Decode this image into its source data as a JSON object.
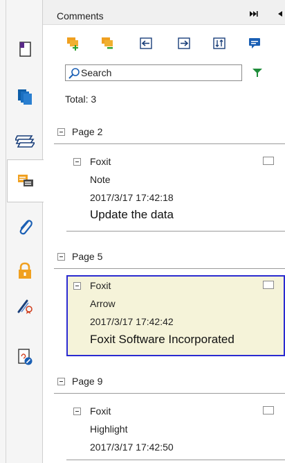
{
  "panel": {
    "title": "Comments",
    "collapse_glyph": "⏩",
    "prev_glyph": "◀"
  },
  "toolbar": {
    "buttons": [
      {
        "name": "expand-all-icon"
      },
      {
        "name": "collapse-all-icon"
      },
      {
        "name": "import-comments-icon"
      },
      {
        "name": "export-comments-icon"
      },
      {
        "name": "sort-comments-icon"
      },
      {
        "name": "comment-options-icon"
      }
    ]
  },
  "search": {
    "placeholder": "Search"
  },
  "total": {
    "text": "Total: 3"
  },
  "pages": [
    {
      "label": "Page 2",
      "comments": [
        {
          "author": "Foxit",
          "type": "Note",
          "date": "2017/3/17 17:42:18",
          "text": "Update the data",
          "selected": false
        }
      ]
    },
    {
      "label": "Page 5",
      "comments": [
        {
          "author": "Foxit",
          "type": "Arrow",
          "date": "2017/3/17 17:42:42",
          "text": "Foxit Software Incorporated",
          "selected": true
        }
      ]
    },
    {
      "label": "Page 9",
      "comments": [
        {
          "author": "Foxit",
          "type": "Highlight",
          "date": "2017/3/17 17:42:50",
          "text": "",
          "selected": false
        }
      ]
    }
  ],
  "rail": {
    "items": [
      {
        "name": "page-thumbnail-icon"
      },
      {
        "name": "pages-icon"
      },
      {
        "name": "layers-icon"
      },
      {
        "name": "comments-icon"
      },
      {
        "name": "attachments-icon"
      },
      {
        "name": "security-icon"
      },
      {
        "name": "signature-icon"
      },
      {
        "name": "digital-certificate-icon"
      }
    ]
  },
  "colors": {
    "selection_border": "#2a2ad0",
    "selection_background": "#f5f3d9",
    "toolbar_orange": "#f0a020",
    "toolbar_green": "#2aa02a",
    "toolbar_blue": "#1a5fb4",
    "filter_green": "#1e8c3a"
  }
}
